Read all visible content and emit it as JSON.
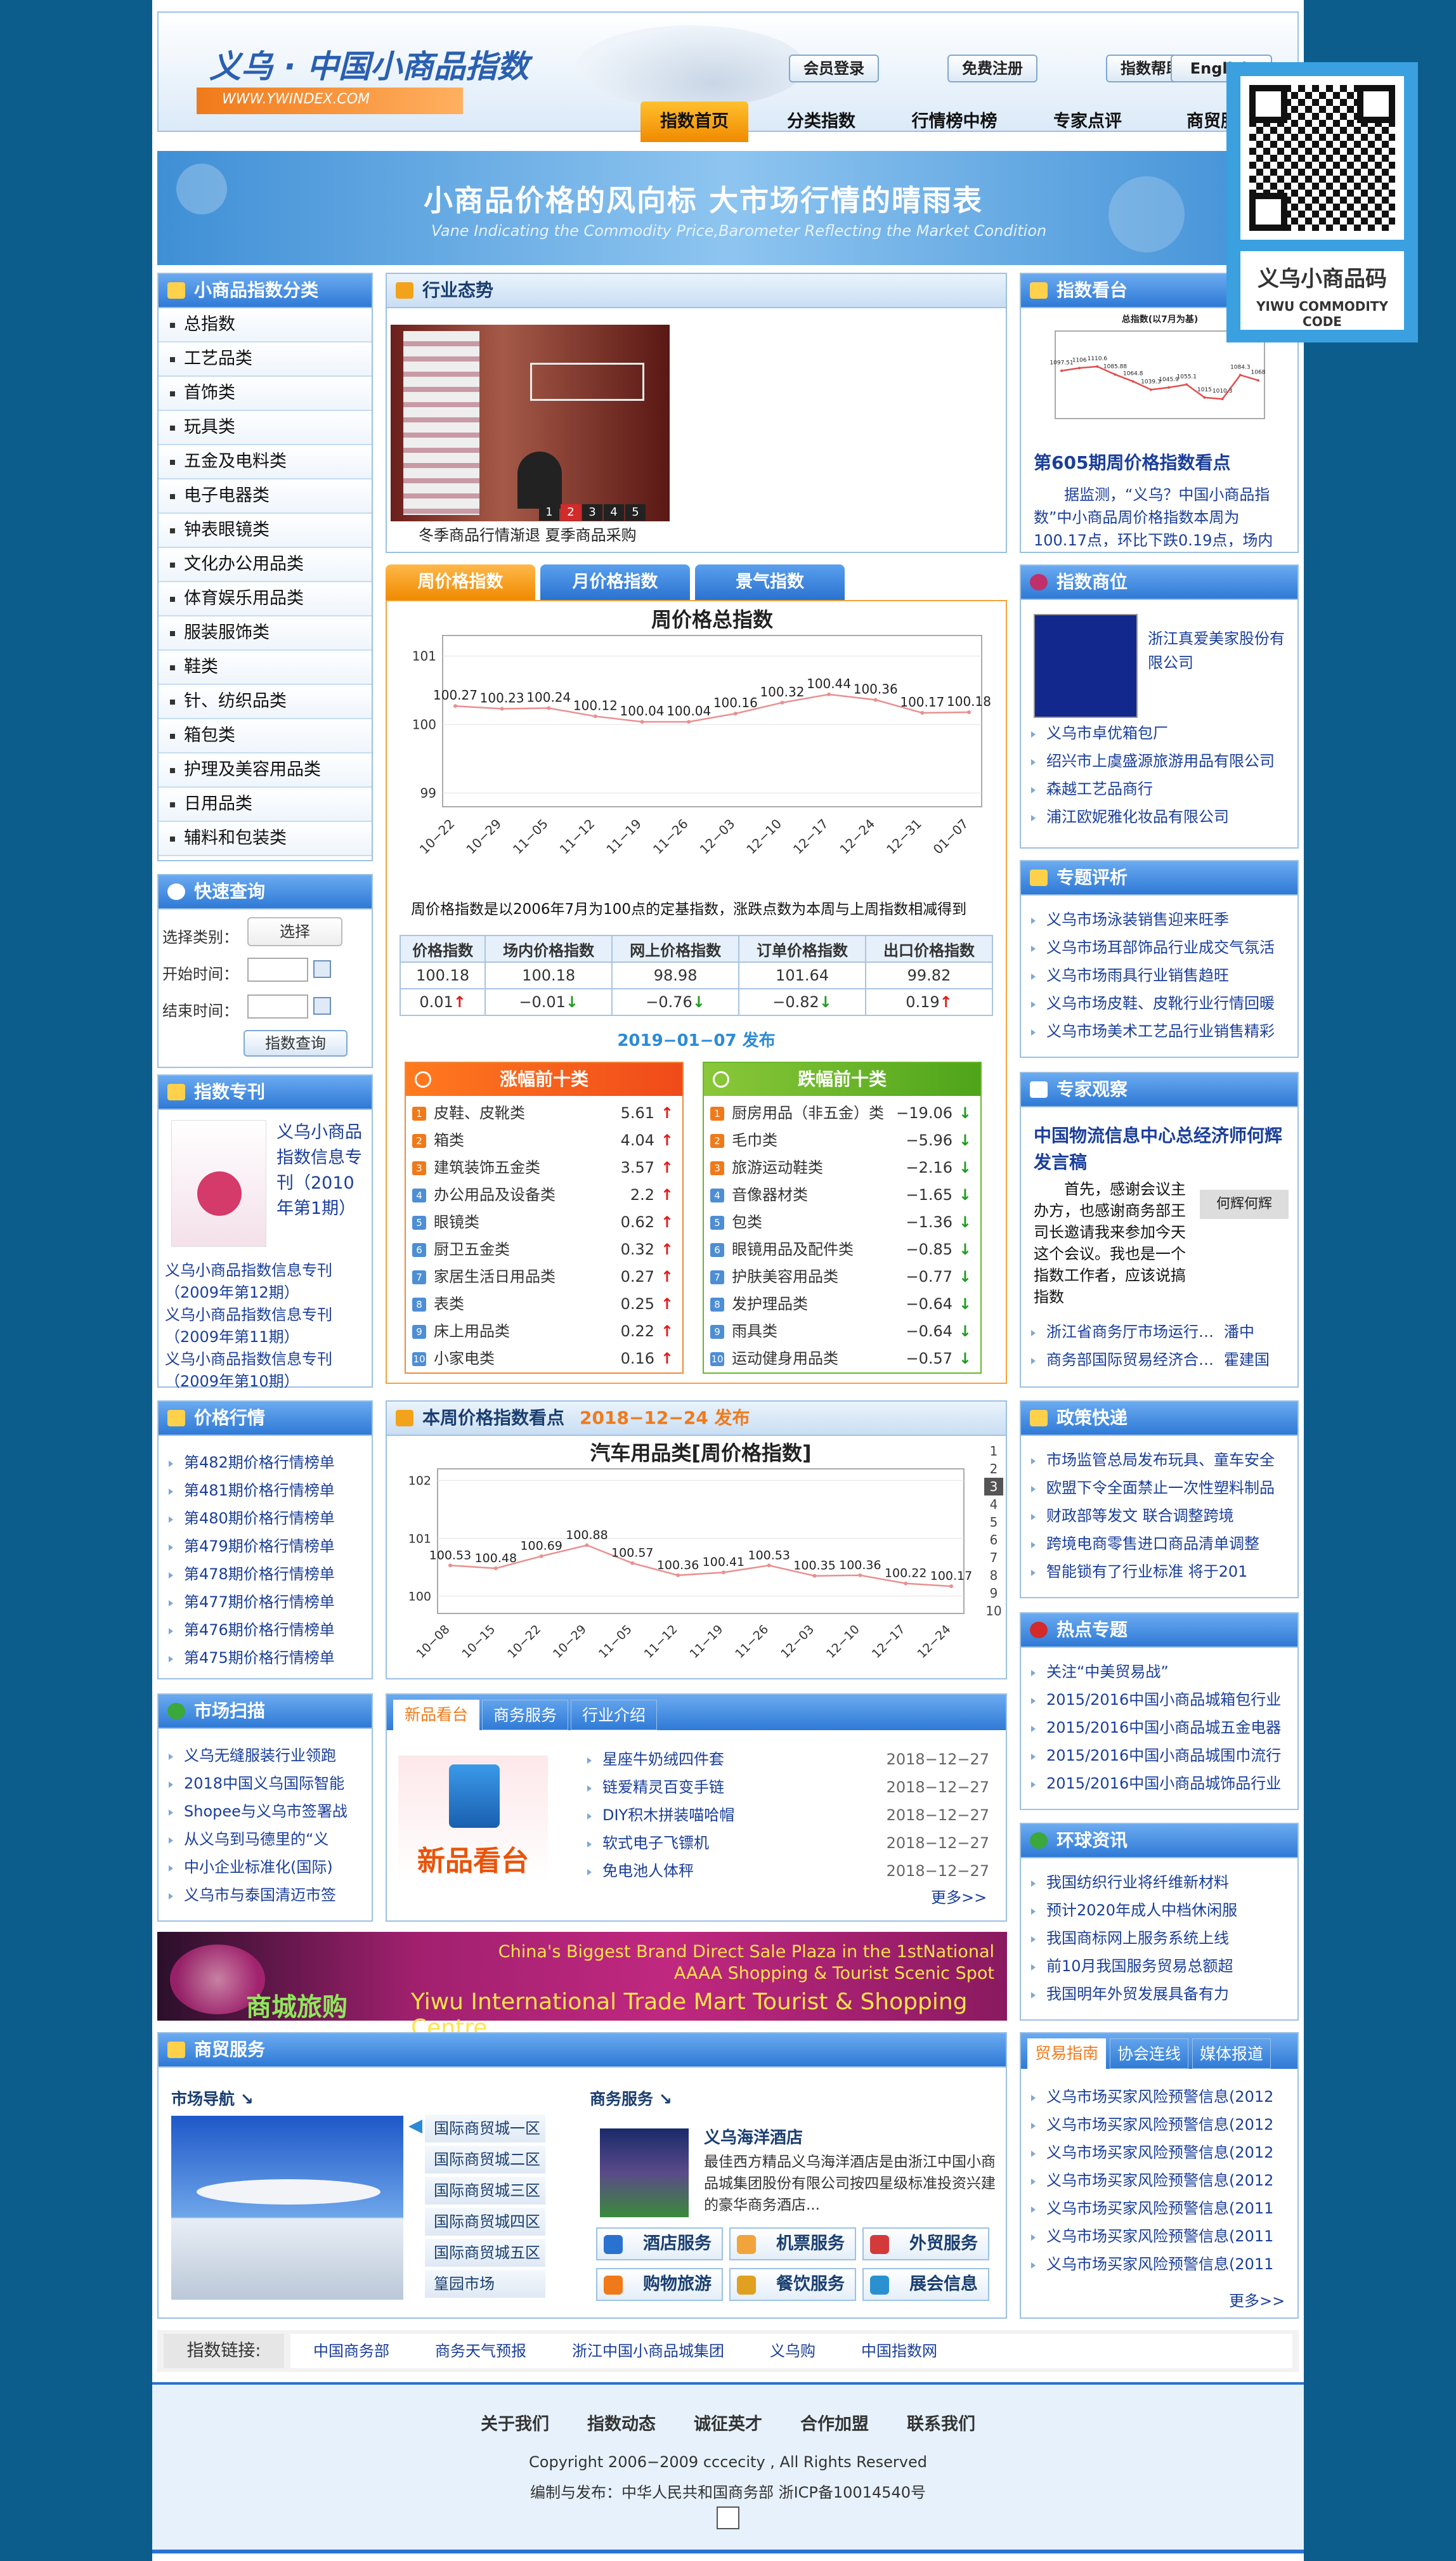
{
  "header": {
    "logo_title": "义乌 · 中国小商品指数",
    "logo_url": "WWW.YWINDEX.COM",
    "buttons": [
      "会员登录",
      "免费注册",
      "指数帮助",
      "English"
    ],
    "nav": [
      "指数首页",
      "分类指数",
      "行情榜中榜",
      "专家点评",
      "商贸服务"
    ],
    "banner_cn": "小商品价格的风向标  大市场行情的晴雨表",
    "banner_en": "Vane Indicating the Commodity Price,Barometer Reflecting the Market Condition"
  },
  "qr": {
    "title": "义乌小商品码",
    "subtitle": "YIWU COMMODITY CODE"
  },
  "left": {
    "cat_title": "小商品指数分类",
    "categories": [
      "总指数",
      "工艺品类",
      "首饰类",
      "玩具类",
      "五金及电料类",
      "电子电器类",
      "钟表眼镜类",
      "文化办公用品类",
      "体育娱乐用品类",
      "服装服饰类",
      "鞋类",
      "针、纺织品类",
      "箱包类",
      "护理及美容用品类",
      "日用品类",
      "辅料和包装类"
    ],
    "quick_title": "快速查询",
    "q_type": "选择类别：",
    "q_select": "选择",
    "q_start": "开始时间：",
    "q_end": "结束时间：",
    "q_btn": "指数查询",
    "journal_title": "指数专刊",
    "journal_main": "义乌小商品指数信息专刊（2010年第1期）",
    "journal_links": [
      "义乌小商品指数信息专刊（2009年第12期）",
      "义乌小商品指数信息专刊（2009年第11期）",
      "义乌小商品指数信息专刊（2009年第10期）"
    ],
    "price_title": "价格行情",
    "price_links": [
      "第482期价格行情榜单",
      "第481期价格行情榜单",
      "第480期价格行情榜单",
      "第479期价格行情榜单",
      "第478期价格行情榜单",
      "第477期价格行情榜单",
      "第476期价格行情榜单",
      "第475期价格行情榜单"
    ],
    "scan_title": "市场扫描",
    "scan_links": [
      "义乌无缝服装行业领跑",
      "2018中国义乌国际智能",
      "Shopee与义乌市签署战",
      "从义乌到马德里的“义",
      "中小企业标准化(国际)",
      "义乌市与泰国清迈市签"
    ]
  },
  "mid": {
    "trend_title": "行业态势",
    "trend_caption": "冬季商品行情渐退  夏季商品采购",
    "slide_nums": [
      "1",
      "2",
      "3",
      "4",
      "5"
    ],
    "tabs": [
      "周价格指数",
      "月价格指数",
      "景气指数"
    ],
    "note": "周价格指数是以2006年7月为100点的定基指数，涨跌点数为本周与上周指数相减得到",
    "idx_head": [
      "价格指数",
      "场内价格指数",
      "网上价格指数",
      "订单价格指数",
      "出口价格指数"
    ],
    "idx_vals": [
      "100.18",
      "100.18",
      "98.98",
      "101.64",
      "99.82"
    ],
    "idx_chg": [
      "0.01",
      "−0.01",
      "−0.76",
      "−0.82",
      "0.19"
    ],
    "idx_dir": [
      "up",
      "dn",
      "dn",
      "dn",
      "up"
    ],
    "publish": "2019−01−07 发布",
    "up_title": "涨幅前十类",
    "down_title": "跌幅前十类",
    "up_list": [
      [
        "皮鞋、皮靴类",
        "5.61"
      ],
      [
        "箱类",
        "4.04"
      ],
      [
        "建筑装饰五金类",
        "3.57"
      ],
      [
        "办公用品及设备类",
        "2.2"
      ],
      [
        "眼镜类",
        "0.62"
      ],
      [
        "厨卫五金类",
        "0.32"
      ],
      [
        "家居生活日用品类",
        "0.27"
      ],
      [
        "表类",
        "0.25"
      ],
      [
        "床上用品类",
        "0.22"
      ],
      [
        "小家电类",
        "0.16"
      ]
    ],
    "down_list": [
      [
        "厨房用品（非五金）类",
        "−19.06"
      ],
      [
        "毛巾类",
        "−5.96"
      ],
      [
        "旅游运动鞋类",
        "−2.16"
      ],
      [
        "音像器材类",
        "−1.65"
      ],
      [
        "包类",
        "−1.36"
      ],
      [
        "眼镜用品及配件类",
        "−0.85"
      ],
      [
        "护肤美容用品类",
        "−0.77"
      ],
      [
        "发护理品类",
        "−0.64"
      ],
      [
        "雨具类",
        "−0.64"
      ],
      [
        "运动健身用品类",
        "−0.57"
      ]
    ],
    "week_title": "本周价格指数看点",
    "week_date": "2018−12−24 发布",
    "week_pages": [
      "1",
      "2",
      "3",
      "4",
      "5",
      "6",
      "7",
      "8",
      "9",
      "10"
    ],
    "news_tabs": [
      "新品看台",
      "商务服务",
      "行业介绍"
    ],
    "news_img": "新品看台",
    "news": [
      [
        "星座牛奶绒四件套",
        "2018−12−27"
      ],
      [
        "链爱精灵百变手链",
        "2018−12−27"
      ],
      [
        "DIY积木拼装喵哈帽",
        "2018−12−27"
      ],
      [
        "软式电子飞镖机",
        "2018−12−27"
      ],
      [
        "免电池人体秤",
        "2018−12−27"
      ]
    ],
    "more": "更多>>",
    "ad_en1": "China's Biggest Brand Direct Sale Plaza in the 1stNational",
    "ad_en2": "AAAA Shopping & Tourist Scenic Spot",
    "ad_en3": "Yiwu International Trade Mart Tourist & Shopping Centre",
    "ad_cn": "商城旅购"
  },
  "right": {
    "watch_title": "指数看台",
    "watch_headline": "第605期周价格指数看点",
    "watch_text": "据监测，“义乌？中国小商品指数”中小商品周价格指数本周为100.17点，环比下跌0.19点，场内",
    "sponsor_title": "指数商位",
    "sponsor_main": "浙江真爱美家股份有限公司",
    "sponsor_links": [
      "义乌市卓优箱包厂",
      "绍兴市上虞盛源旅游用品有限公司",
      "森越工艺品商行",
      "浦江欧妮雅化妆品有限公司"
    ],
    "topic_title": "专题评析",
    "topic_links": [
      "义乌市场泳装销售迎来旺季",
      "义乌市场耳部饰品行业成交气氛活",
      "义乌市场雨具行业销售趋旺",
      "义乌市场皮鞋、皮靴行业行情回暖",
      "义乌市场美术工艺品行业销售精彩"
    ],
    "expert_title": "专家观察",
    "expert_headline": "中国物流信息中心总经济师何辉发言稿",
    "expert_img": "何辉何辉",
    "expert_text": "首先，感谢会议主办方，也感谢商务部王司长邀请我来参加今天这个会议。我也是一个指数工作者，应该说搞指数",
    "expert_links": [
      [
        "浙江省商务厅市场运行…",
        "潘中"
      ],
      [
        "商务部国际贸易经济合…",
        "霍建国"
      ]
    ],
    "policy_title": "政策快递",
    "policy_links": [
      "市场监管总局发布玩具、童车安全",
      "欧盟下令全面禁止一次性塑料制品",
      "财政部等发文 联合调整跨境",
      "跨境电商零售进口商品清单调整",
      "智能锁有了行业标准 将于201"
    ],
    "hot_title": "热点专题",
    "hot_links": [
      "关注“中美贸易战”",
      "2015/2016中国小商品城箱包行业",
      "2015/2016中国小商品城五金电器",
      "2015/2016中国小商品城围巾流行",
      "2015/2016中国小商品城饰品行业"
    ],
    "global_title": "环球资讯",
    "global_links": [
      "我国纺织行业将纤维新材料",
      "预计2020年成人中档休闲服",
      "我国商标网上服务系统上线",
      "前10月我国服务贸易总额超",
      "我国明年外贸发展具备有力"
    ],
    "trade_tabs": [
      "贸易指南",
      "协会连线",
      "媒体报道"
    ],
    "trade_links": [
      "义乌市场买家风险预警信息(2012",
      "义乌市场买家风险预警信息(2012",
      "义乌市场买家风险预警信息(2012",
      "义乌市场买家风险预警信息(2012",
      "义乌市场买家风险预警信息(2011",
      "义乌市场买家风险预警信息(2011",
      "义乌市场买家风险预警信息(2011"
    ],
    "more": "更多>>"
  },
  "service": {
    "title": "商贸服务",
    "nav_label": "市场导航 ↘",
    "biz_label": "商务服务 ↘",
    "districts": [
      "国际商贸城一区",
      "国际商贸城二区",
      "国际商贸城三区",
      "国际商贸城四区",
      "国际商贸城五区",
      "篁园市场"
    ],
    "hotel_name": "义乌海洋酒店",
    "hotel_text": "最佳西方精品义乌海洋酒店是由浙江中国小商品城集团股份有限公司按四星级标准投资兴建的豪华商务酒店...",
    "btns": [
      "酒店服务",
      "机票服务",
      "外贸服务",
      "购物旅游",
      "餐饮服务",
      "展会信息"
    ]
  },
  "links": {
    "label": "指数链接:",
    "items": [
      "中国商务部",
      "商务天气预报",
      "浙江中国小商品城集团",
      "义乌购",
      "中国指数网"
    ]
  },
  "footer": {
    "menu": [
      "关于我们",
      "指数动态",
      "诚征英才",
      "合作加盟",
      "联系我们"
    ],
    "copyright": "Copyright 2006−2009 cccecity , All Rights Reserved",
    "publisher": "编制与发布：中华人民共和国商务部 浙ICP备10014540号"
  },
  "chart_data": [
    {
      "type": "line",
      "title": "周价格总指数",
      "categories": [
        "10−22",
        "10−29",
        "11−05",
        "11−12",
        "11−19",
        "11−26",
        "12−03",
        "12−10",
        "12−17",
        "12−24",
        "12−31",
        "01−07"
      ],
      "values": [
        100.27,
        100.23,
        100.24,
        100.12,
        100.04,
        100.04,
        100.16,
        100.32,
        100.44,
        100.36,
        100.17,
        100.18
      ],
      "ylim": [
        98.8,
        101.3
      ],
      "yticks": [
        99,
        100,
        101
      ]
    },
    {
      "type": "line",
      "title": "汽车用品类[周价格指数]",
      "categories": [
        "10−08",
        "10−15",
        "10−22",
        "10−29",
        "11−05",
        "11−12",
        "11−19",
        "11−26",
        "12−03",
        "12−10",
        "12−17",
        "12−24"
      ],
      "values": [
        100.53,
        100.48,
        100.69,
        100.88,
        100.57,
        100.36,
        100.41,
        100.53,
        100.35,
        100.36,
        100.22,
        100.17
      ],
      "ylim": [
        99.7,
        102.2
      ],
      "yticks": [
        100,
        101,
        102
      ]
    },
    {
      "type": "line",
      "title": "总指数(以7月为基)",
      "values": [
        1097.51,
        1106,
        1110.6,
        1085.88,
        1064.8,
        1039.3,
        1045.9,
        1055.1,
        1015,
        1010.3,
        1084.3,
        1068
      ],
      "ylim": [
        950,
        1220
      ]
    }
  ],
  "colors": {
    "bg": "#0d5d8c",
    "accent": "#2a72d0",
    "orange": "#f08a00",
    "up": "#e21a1a",
    "down": "#1f9b1f"
  }
}
